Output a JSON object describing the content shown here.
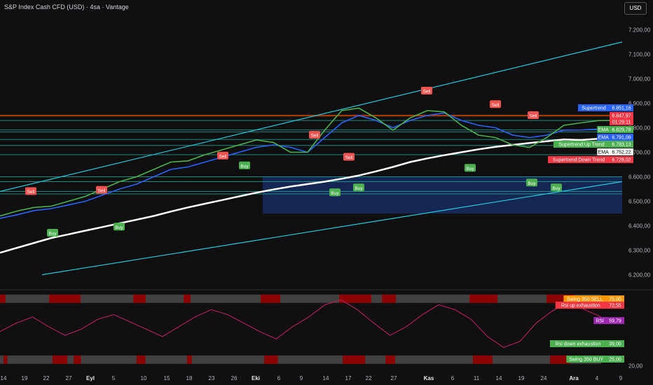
{
  "header": {
    "title": "S&P Index Cash CFD (USD) · 4sa · Vantage",
    "currency_button": "USD"
  },
  "colors": {
    "background": "#0f0f0f",
    "channel": "#26c6da",
    "ema_long": "#ffffff",
    "ema_mid": "#2962ff",
    "ema_fast": "#4caf50",
    "supertrend_up": "#4caf50",
    "supertrend_down": "#ef5350",
    "zone_blue": "#1a3a8a",
    "rsi": "#b31f5d",
    "swing_sell": "#ff9800",
    "swing_buy": "#4caf50"
  },
  "chart_data": [
    {
      "type": "line",
      "panel": "price",
      "ylim": [
        6150,
        7250
      ],
      "y_ticks": [
        "7.200,00",
        "7.100,00",
        "7.000,00",
        "6.900,00",
        "6.800,00",
        "6.700,00",
        "6.600,00",
        "6.500,00",
        "6.400,00",
        "6.300,00",
        "6.200,00"
      ],
      "x_ticks": [
        "14",
        "19",
        "22",
        "27",
        "Eyl",
        "5",
        "10",
        "15",
        "18",
        "23",
        "26",
        "Eki",
        "6",
        "9",
        "14",
        "17",
        "22",
        "27",
        "Kas",
        "6",
        "11",
        "14",
        "19",
        "24",
        "Ara",
        "4",
        "9"
      ],
      "x_ticks_bold": [
        "Eyl",
        "Eki",
        "Kas",
        "Ara"
      ],
      "grid": false,
      "series": [
        {
          "name": "EMA",
          "role": "ema_long",
          "values": [
            6290,
            6310,
            6330,
            6350,
            6365,
            6380,
            6395,
            6410,
            6425,
            6440,
            6458,
            6475,
            6490,
            6505,
            6520,
            6535,
            6548,
            6560,
            6570,
            6580,
            6592,
            6605,
            6622,
            6640,
            6660,
            6675,
            6688,
            6700,
            6712,
            6722,
            6730,
            6738,
            6745,
            6752,
            6750,
            6755,
            6752
          ]
        },
        {
          "name": "EMA",
          "role": "ema_mid",
          "values": [
            6430,
            6445,
            6462,
            6470,
            6485,
            6500,
            6525,
            6550,
            6570,
            6600,
            6630,
            6640,
            6660,
            6680,
            6700,
            6720,
            6730,
            6720,
            6700,
            6760,
            6820,
            6850,
            6830,
            6800,
            6830,
            6850,
            6860,
            6830,
            6810,
            6800,
            6770,
            6760,
            6770,
            6790,
            6791,
            6795,
            6791
          ]
        },
        {
          "name": "EMA",
          "role": "ema_fast",
          "values": [
            6440,
            6460,
            6475,
            6480,
            6500,
            6520,
            6550,
            6580,
            6600,
            6630,
            6660,
            6665,
            6690,
            6710,
            6730,
            6750,
            6740,
            6700,
            6700,
            6790,
            6870,
            6880,
            6840,
            6790,
            6840,
            6870,
            6865,
            6810,
            6770,
            6760,
            6730,
            6720,
            6760,
            6810,
            6820,
            6829,
            6830
          ]
        }
      ],
      "channel": {
        "upper": [
          6540,
          7150
        ],
        "lower": [
          6200,
          6580
        ]
      },
      "horizontal_levels": [
        6851.16,
        6847.97,
        6829.78,
        6791.08,
        6783.13,
        6752.22,
        6728.02,
        6690,
        6600,
        6580,
        6540,
        6530
      ],
      "zone": {
        "from": 6450,
        "to": 6600
      },
      "signals": [
        {
          "type": "Sell",
          "value": 6540
        },
        {
          "type": "Sell",
          "value": 6545
        },
        {
          "type": "Buy",
          "value": 6370
        },
        {
          "type": "Buy",
          "value": 6395
        },
        {
          "type": "Sell",
          "value": 6685
        },
        {
          "type": "Buy",
          "value": 6645
        },
        {
          "type": "Sell",
          "value": 6770
        },
        {
          "type": "Buy",
          "value": 6535
        },
        {
          "type": "Sell",
          "value": 6680
        },
        {
          "type": "Buy",
          "value": 6555
        },
        {
          "type": "Sell",
          "value": 6950
        },
        {
          "type": "Sell",
          "value": 6895
        },
        {
          "type": "Buy",
          "value": 6635
        },
        {
          "type": "Sell",
          "value": 6850
        },
        {
          "type": "Buy",
          "value": 6575
        },
        {
          "type": "Buy",
          "value": 6555
        }
      ],
      "labels": [
        {
          "text": "Supertrend",
          "value": "6.851,16"
        },
        {
          "text": "",
          "value": "6.847,97"
        },
        {
          "text": "",
          "value": "01:29:11"
        },
        {
          "text": "EMA",
          "value": "6.829,78"
        },
        {
          "text": "EMA",
          "value": "6.791,08"
        },
        {
          "text": "Supertrend:Up Trend",
          "value": "6.783,13"
        },
        {
          "text": "EMA",
          "value": "6.752,22"
        },
        {
          "text": "Supertrend:Down Trend",
          "value": "6.728,02"
        }
      ]
    },
    {
      "type": "line",
      "panel": "rsi",
      "ylim": [
        18,
        80
      ],
      "y_ticks": [
        "20,00"
      ],
      "series": [
        {
          "name": "RSI",
          "values": [
            48,
            55,
            60,
            52,
            45,
            50,
            58,
            62,
            56,
            50,
            44,
            52,
            60,
            66,
            62,
            55,
            48,
            42,
            52,
            60,
            70,
            74,
            66,
            55,
            45,
            52,
            62,
            70,
            66,
            58,
            44,
            35,
            40,
            55,
            65,
            72,
            66,
            60
          ]
        }
      ],
      "levels": [
        {
          "text": "Swing 350 SELL",
          "value": "75,00"
        },
        {
          "text": "Rsi up exhaustion",
          "value": "72,55"
        },
        {
          "text": "RSI",
          "value": "59,79"
        },
        {
          "text": "Rsi down exhaustion",
          "value": "39,00"
        },
        {
          "text": "Swing 350 BUY",
          "value": "25,00"
        }
      ]
    }
  ]
}
